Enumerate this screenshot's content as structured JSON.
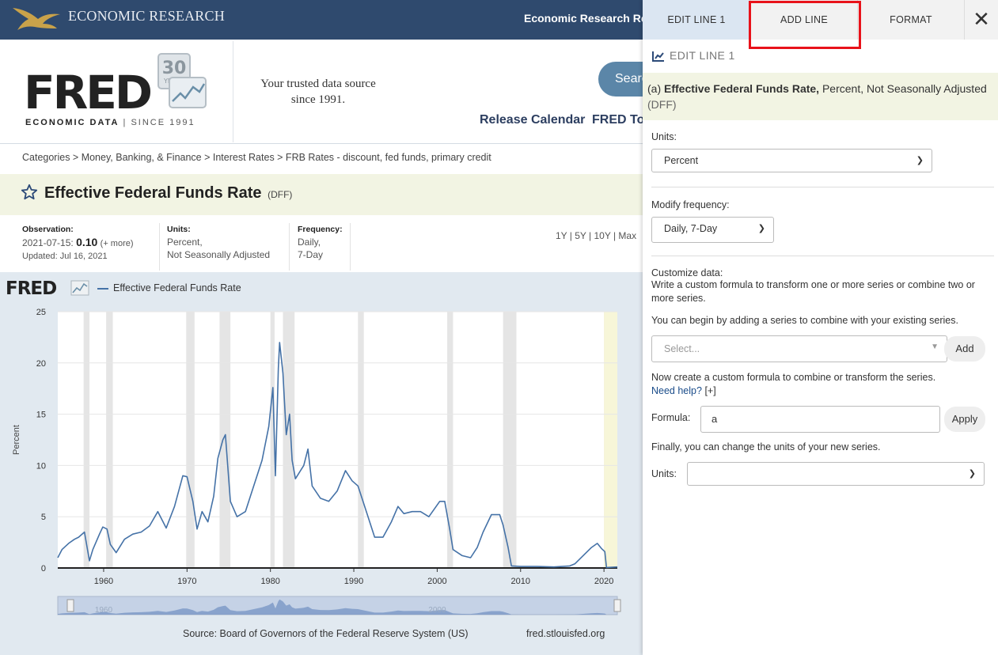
{
  "topbar": {
    "brand": "ECONOMIC RESEARCH",
    "link": "Economic Research Res"
  },
  "header": {
    "logo": "FRED",
    "logo_sub_bold": "ECONOMIC DATA",
    "logo_sub": "| SINCE 1991",
    "badge_num": "30",
    "badge_word": "YEARS",
    "tagline_1": "Your trusted data source",
    "tagline_2": "since 1991.",
    "search_label": "Search",
    "release_calendar": "Release Calendar",
    "fred_tools": "FRED Tools"
  },
  "breadcrumb": "Categories > Money, Banking, & Finance > Interest Rates > FRB Rates - discount, fed funds, primary credit",
  "series": {
    "title": "Effective Federal Funds Rate",
    "id": "(DFF)"
  },
  "meta": {
    "observation_label": "Observation:",
    "observation_date": "2021-07-15:",
    "observation_value": "0.10",
    "observation_more": "(+ more)",
    "updated": "Updated: Jul 16, 2021",
    "units_label": "Units:",
    "units_1": "Percent,",
    "units_2": "Not Seasonally Adjusted",
    "frequency_label": "Frequency:",
    "frequency_1": "Daily,",
    "frequency_2": "7-Day",
    "ranges": "1Y | 5Y | 10Y | Max"
  },
  "chart_legend": {
    "logo": "FRED",
    "series": "Effective Federal Funds Rate"
  },
  "chart_data": {
    "type": "line",
    "ylabel": "Percent",
    "ylim": [
      0,
      25
    ],
    "xlim": [
      1954.5,
      2021.6
    ],
    "yticks": [
      0,
      5,
      10,
      15,
      20,
      25
    ],
    "xticks": [
      1960,
      1970,
      1980,
      1990,
      2000,
      2010,
      2020
    ],
    "series": [
      {
        "name": "Effective Federal Funds Rate",
        "points": [
          [
            1954.5,
            1.0
          ],
          [
            1955,
            1.8
          ],
          [
            1955.8,
            2.4
          ],
          [
            1956.5,
            2.8
          ],
          [
            1957,
            3.0
          ],
          [
            1957.7,
            3.5
          ],
          [
            1958.3,
            0.7
          ],
          [
            1958.7,
            1.8
          ],
          [
            1959.5,
            3.3
          ],
          [
            1959.9,
            4.0
          ],
          [
            1960.4,
            3.8
          ],
          [
            1960.8,
            2.3
          ],
          [
            1961.5,
            1.5
          ],
          [
            1962.5,
            2.8
          ],
          [
            1963.5,
            3.3
          ],
          [
            1964.5,
            3.5
          ],
          [
            1965.5,
            4.1
          ],
          [
            1966.5,
            5.5
          ],
          [
            1967.5,
            3.9
          ],
          [
            1968.5,
            6.0
          ],
          [
            1969.5,
            9.0
          ],
          [
            1970,
            8.9
          ],
          [
            1970.7,
            6.5
          ],
          [
            1971.2,
            3.8
          ],
          [
            1971.8,
            5.5
          ],
          [
            1972.5,
            4.5
          ],
          [
            1973.2,
            7.0
          ],
          [
            1973.7,
            10.7
          ],
          [
            1974.3,
            12.5
          ],
          [
            1974.6,
            13.0
          ],
          [
            1975.2,
            6.5
          ],
          [
            1976,
            5.0
          ],
          [
            1977,
            5.5
          ],
          [
            1978,
            8.0
          ],
          [
            1979,
            10.5
          ],
          [
            1979.8,
            13.8
          ],
          [
            1980.3,
            17.6
          ],
          [
            1980.6,
            9.0
          ],
          [
            1980.95,
            19.5
          ],
          [
            1981.1,
            22.0
          ],
          [
            1981.5,
            19.0
          ],
          [
            1981.9,
            13.0
          ],
          [
            1982.3,
            15.0
          ],
          [
            1982.6,
            10.5
          ],
          [
            1983,
            8.7
          ],
          [
            1984,
            10.0
          ],
          [
            1984.5,
            11.6
          ],
          [
            1985,
            8.0
          ],
          [
            1986,
            6.8
          ],
          [
            1987,
            6.5
          ],
          [
            1988,
            7.5
          ],
          [
            1989,
            9.5
          ],
          [
            1989.8,
            8.5
          ],
          [
            1990.5,
            8.0
          ],
          [
            1991.5,
            5.5
          ],
          [
            1992.5,
            3.0
          ],
          [
            1993.5,
            3.0
          ],
          [
            1994.5,
            4.5
          ],
          [
            1995.3,
            6.0
          ],
          [
            1996,
            5.3
          ],
          [
            1997,
            5.5
          ],
          [
            1998,
            5.5
          ],
          [
            1999,
            5.0
          ],
          [
            2000.3,
            6.5
          ],
          [
            2000.9,
            6.5
          ],
          [
            2001.5,
            3.8
          ],
          [
            2001.9,
            1.8
          ],
          [
            2003,
            1.2
          ],
          [
            2004,
            1.0
          ],
          [
            2004.8,
            2.0
          ],
          [
            2005.5,
            3.5
          ],
          [
            2006.5,
            5.2
          ],
          [
            2007.5,
            5.2
          ],
          [
            2007.9,
            4.2
          ],
          [
            2008.5,
            2.0
          ],
          [
            2008.9,
            0.2
          ],
          [
            2010,
            0.15
          ],
          [
            2012,
            0.15
          ],
          [
            2014,
            0.1
          ],
          [
            2015.9,
            0.2
          ],
          [
            2016.5,
            0.4
          ],
          [
            2017.5,
            1.2
          ],
          [
            2018.5,
            2.0
          ],
          [
            2019.2,
            2.4
          ],
          [
            2019.7,
            1.9
          ],
          [
            2020.1,
            1.6
          ],
          [
            2020.3,
            0.05
          ],
          [
            2021.6,
            0.1
          ]
        ]
      }
    ]
  },
  "navigator": {
    "label_1960": "1960",
    "label_2000": "2000"
  },
  "source": "Source: Board of Governors of the Federal Reserve System (US)",
  "site": "fred.stlouisfed.org",
  "panel": {
    "tabs": [
      "EDIT LINE 1",
      "ADD LINE",
      "FORMAT"
    ],
    "close": "✕",
    "edit_head": "EDIT LINE 1",
    "series_prefix": "(a)",
    "series_name": "Effective Federal Funds Rate,",
    "series_desc": "Percent, Not Seasonally Adjusted",
    "series_code": "(DFF)",
    "units_label": "Units:",
    "units_value": "Percent",
    "modify_label": "Modify frequency:",
    "modify_value": "Daily, 7-Day",
    "customize_label": "Customize data:",
    "customize_desc": "Write a custom formula to transform one or more series or combine two or more series.",
    "begin_text": "You can begin by adding a series to combine with your existing series.",
    "select_placeholder": "Select...",
    "add_label": "Add",
    "create_text": "Now create a custom formula to combine or transform the series.",
    "help_text": "Need help?",
    "help_plus": "[+]",
    "formula_label": "Formula:",
    "formula_value": "a",
    "apply_label": "Apply",
    "finally_text": "Finally, you can change the units of your new series.",
    "units2_label": "Units:",
    "units2_value": ""
  }
}
